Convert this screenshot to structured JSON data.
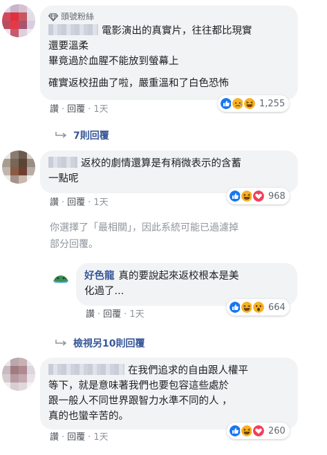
{
  "comments": [
    {
      "badge": "頭號粉絲",
      "lines": [
        "電影演出的真實片，往往都比現實",
        "還要溫柔",
        "畢竟過於血腥不能放到螢幕上",
        "",
        "確實返校扭曲了啦，嚴重溫和了白色恐怖"
      ],
      "actions": {
        "like": "讚",
        "reply": "回覆",
        "time": "1天"
      },
      "reactions": [
        "like",
        "haha-sad",
        "haha"
      ],
      "reaction_count": "1,255",
      "replies_label": "7則回覆"
    },
    {
      "lines": [
        "返校的劇情還算是有稍微表示的含蓄",
        "一點呢"
      ],
      "actions": {
        "like": "讚",
        "reply": "回覆",
        "time": "1天"
      },
      "reactions": [
        "like",
        "haha",
        "love"
      ],
      "reaction_count": "968"
    },
    {
      "author": "好色龍",
      "lines": [
        "真的要說起來返校根本是美",
        "化過了..."
      ],
      "actions": {
        "like": "讚",
        "reply": "回覆",
        "time": "1天"
      },
      "reactions": [
        "like",
        "haha",
        "wow"
      ],
      "reaction_count": "664"
    },
    {
      "lines": [
        "在我們追求的自由跟人權平",
        "等下，就是意味著我們也要包容這些處於",
        "跟一般人不同世界跟智力水準不同的人 ，",
        "真的也蠻辛苦的。"
      ],
      "actions": {
        "like": "讚",
        "reply": "回覆",
        "time": "1天"
      },
      "reactions": [
        "like",
        "haha",
        "love"
      ],
      "reaction_count": "260"
    }
  ],
  "filter_notice": [
    "你選擇了「最相關」，因此系統可能已過濾掉",
    "部分回覆。"
  ],
  "more_replies": {
    "prefix": "檢視另",
    "count": "10",
    "suffix": "則回覆"
  },
  "colors": {
    "link": "#385898",
    "bubble": "#f2f3f5",
    "like": "#1877f2",
    "haha": "#f7b125",
    "love": "#f33e58"
  }
}
